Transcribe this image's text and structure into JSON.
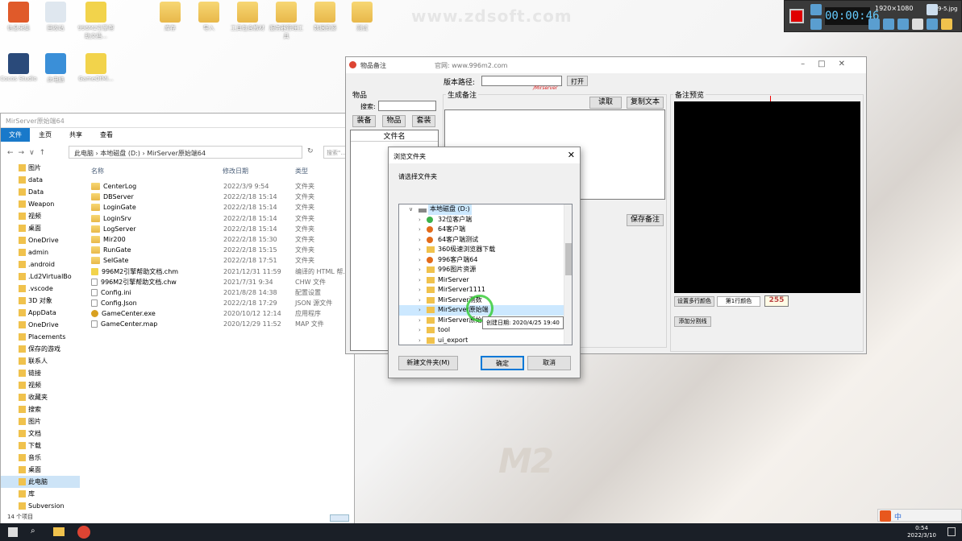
{
  "watermark": "www.zdsoft.com",
  "recorder": {
    "timer": "00:00:46",
    "resolution": "1920×1080",
    "file": "9-5.jpg"
  },
  "desktop_icons": [
    {
      "label": "信息采集",
      "kind": "app",
      "color": "#e05a2a"
    },
    {
      "label": "回收站",
      "kind": "bin",
      "color": "#dfe7ef"
    },
    {
      "label": "996M2引擎帮助文档...",
      "kind": "help",
      "color": "#f2d34b"
    },
    {
      "label": "库存",
      "kind": "folder"
    },
    {
      "label": "导入",
      "kind": "folder"
    },
    {
      "label": "工具包含教材",
      "kind": "folder"
    },
    {
      "label": "服务器管理工具",
      "kind": "folder"
    },
    {
      "label": "数据资源",
      "kind": "folder"
    },
    {
      "label": "测试",
      "kind": "folder"
    },
    {
      "label": "Cocos Studio",
      "kind": "app",
      "color": "#2a4a7a"
    },
    {
      "label": "此电脑",
      "kind": "pc",
      "color": "#3a8fd8"
    },
    {
      "label": "GameOfMi...",
      "kind": "help",
      "color": "#f2d34b"
    }
  ],
  "explorer": {
    "title": "MirServer原始端64",
    "ribbon": [
      "文件",
      "主页",
      "共享",
      "查看"
    ],
    "breadcrumb": "此电脑  ›  本地磁盘 (D:)  ›  MirServer原始端64",
    "search_placeholder": "搜索\"...",
    "columns": [
      "名称",
      "修改日期",
      "类型"
    ],
    "sidebar": [
      "图片",
      "data",
      "Data",
      "Weapon",
      "视频",
      "桌面",
      "OneDrive",
      "admin",
      ".android",
      ".Ld2VirtualBo",
      ".vscode",
      "3D 对象",
      "AppData",
      "OneDrive",
      "Placements",
      "保存的游戏",
      "联系人",
      "链接",
      "视频",
      "收藏夹",
      "搜索",
      "图片",
      "文档",
      "下载",
      "音乐",
      "桌面",
      "此电脑",
      "库",
      "Subversion"
    ],
    "files": [
      {
        "name": "CenterLog",
        "date": "2022/3/9 9:54",
        "type": "文件夹",
        "icon": "folder"
      },
      {
        "name": "DBServer",
        "date": "2022/2/18 15:14",
        "type": "文件夹",
        "icon": "folder"
      },
      {
        "name": "LoginGate",
        "date": "2022/2/18 15:14",
        "type": "文件夹",
        "icon": "folder"
      },
      {
        "name": "LoginSrv",
        "date": "2022/2/18 15:14",
        "type": "文件夹",
        "icon": "folder"
      },
      {
        "name": "LogServer",
        "date": "2022/2/18 15:14",
        "type": "文件夹",
        "icon": "folder"
      },
      {
        "name": "Mir200",
        "date": "2022/2/18 15:30",
        "type": "文件夹",
        "icon": "folder"
      },
      {
        "name": "RunGate",
        "date": "2022/2/18 15:15",
        "type": "文件夹",
        "icon": "folder"
      },
      {
        "name": "SelGate",
        "date": "2022/2/18 17:51",
        "type": "文件夹",
        "icon": "folder"
      },
      {
        "name": "996M2引擎帮助文档.chm",
        "date": "2021/12/31 11:59",
        "type": "编译的 HTML 帮...",
        "icon": "chm"
      },
      {
        "name": "996M2引擎帮助文档.chw",
        "date": "2021/7/31 9:34",
        "type": "CHW 文件",
        "icon": "file"
      },
      {
        "name": "Config.ini",
        "date": "2021/8/28 14:38",
        "type": "配置设置",
        "icon": "file"
      },
      {
        "name": "Config.Json",
        "date": "2022/2/18 17:29",
        "type": "JSON 源文件",
        "icon": "file"
      },
      {
        "name": "GameCenter.exe",
        "date": "2020/10/12 12:14",
        "type": "应用程序",
        "icon": "exe"
      },
      {
        "name": "GameCenter.map",
        "date": "2020/12/29 11:52",
        "type": "MAP 文件",
        "icon": "file"
      }
    ],
    "status": "14 个项目"
  },
  "notes": {
    "title": "物品备注",
    "url": "官网: www.996m2.com",
    "version_label": "版本路径:",
    "open_btn": "打开",
    "items_label": "物品",
    "search_label": "搜索:",
    "tabs": [
      "装备",
      "物品",
      "套装"
    ],
    "list_header": "文件名",
    "generate_label": "生成备注",
    "read_btn": "读取",
    "copy_btn": "复制文本",
    "save_btn": "保存备注",
    "preview_label": "备注预览",
    "multiline_color_btn": "设置多行颜色",
    "line_color": "第1行颜色",
    "color_value": "255",
    "divider_btn": "添加分割线",
    "mirserver_tag": "/Mirserver"
  },
  "dialog": {
    "title": "浏览文件夹",
    "prompt": "请选择文件夹",
    "root": "本地磁盘 (D:)",
    "nodes": [
      {
        "name": "32位客户端",
        "icon": "green"
      },
      {
        "name": "64客户端",
        "icon": "orange"
      },
      {
        "name": "64客户端测试",
        "icon": "orange"
      },
      {
        "name": "360极速浏览器下载",
        "icon": "folder"
      },
      {
        "name": "996客户端64",
        "icon": "orange"
      },
      {
        "name": "996图片资源",
        "icon": "folder"
      },
      {
        "name": "MirServer",
        "icon": "folder"
      },
      {
        "name": "MirServer1111",
        "icon": "folder"
      },
      {
        "name": "MirServer测数",
        "icon": "folder"
      },
      {
        "name": "MirServer原始端",
        "icon": "folder"
      },
      {
        "name": "MirServer原始...",
        "icon": "folder"
      },
      {
        "name": "tool",
        "icon": "folder"
      },
      {
        "name": "ui_export",
        "icon": "folder"
      }
    ],
    "tooltip": "创建日期: 2020/4/25 19:40",
    "new_folder_btn": "新建文件夹(M)",
    "ok_btn": "确定",
    "cancel_btn": "取消"
  },
  "taskbar": {
    "time": "0:54",
    "date": "2022/3/10",
    "ime": "中"
  },
  "brand_bg": "M2"
}
